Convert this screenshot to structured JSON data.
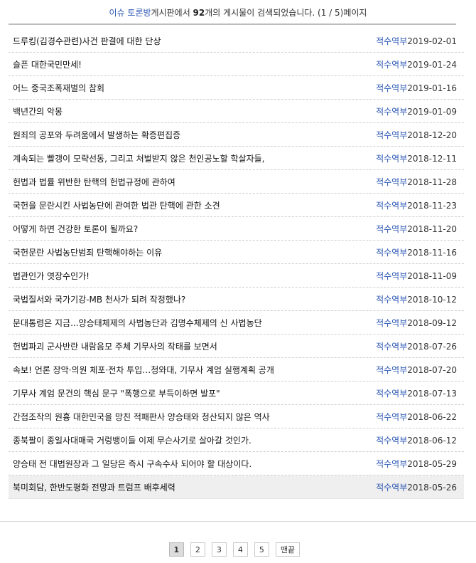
{
  "summary": {
    "board_name": "이슈 토론방",
    "text_after_board": "게시판에서 ",
    "count": "92",
    "text_after_count": "개의 게시물이 검색되었습니다. (1 / 5)페이지"
  },
  "posts": [
    {
      "title": "드루킹(김경수관련)사건 판결에 대한 단상",
      "author": "적수역부",
      "date": "2019-02-01"
    },
    {
      "title": "슬픈 대한국민만세!",
      "author": "적수역부",
      "date": "2019-01-24"
    },
    {
      "title": "어느 중국조폭재벌의 참회",
      "author": "적수역부",
      "date": "2019-01-16"
    },
    {
      "title": "백년간의 악몽",
      "author": "적수역부",
      "date": "2019-01-09"
    },
    {
      "title": "원죄의 공포와 두려움에서 발생하는 확증편집증",
      "author": "적수역부",
      "date": "2018-12-20"
    },
    {
      "title": "계속되는 빨갱이 모략선동, 그리고 처벌받지 않은 천인공노할 학살자들,",
      "author": "적수역부",
      "date": "2018-12-11"
    },
    {
      "title": "헌법과 법률 위반한 탄핵의 헌법규정에 관하여",
      "author": "적수역부",
      "date": "2018-11-28"
    },
    {
      "title": "국헌을 문란시킨 사법농단에 관여한 법관 탄핵에 관한 소견",
      "author": "적수역부",
      "date": "2018-11-23"
    },
    {
      "title": "어떻게 하면 건강한 토론이 될까요?",
      "author": "적수역부",
      "date": "2018-11-20"
    },
    {
      "title": "국헌문란 사법농단범죄 탄핵해야하는 이유",
      "author": "적수역부",
      "date": "2018-11-16"
    },
    {
      "title": "법관인가 엿장수인가!",
      "author": "적수역부",
      "date": "2018-11-09"
    },
    {
      "title": "국법질서와 국가기강-MB 천사가 되려 작정했나?",
      "author": "적수역부",
      "date": "2018-10-12"
    },
    {
      "title": "문대통령은 지금...양승태체제의 사법농단과 김명수체제의 신 사법농단",
      "author": "적수역부",
      "date": "2018-09-12"
    },
    {
      "title": "헌법파괴 군사반란 내람음모 주체 기무사의 작태를 보면서",
      "author": "적수역부",
      "date": "2018-07-26"
    },
    {
      "title": "속보! 언론 장악·의원 체포·전차 투입…청와대, 기무사 계엄 실행계획 공개",
      "author": "적수역부",
      "date": "2018-07-20"
    },
    {
      "title": "기무사 계엄 문건의 핵심 문구 \"폭행으로 부득이하면 발포\"",
      "author": "적수역부",
      "date": "2018-07-13"
    },
    {
      "title": "간첩조작의 원흉 대한민국을 망친 적패판사 양승태와 청산되지 않은 역사",
      "author": "적수역부",
      "date": "2018-06-22"
    },
    {
      "title": "종북팔이 종일사대매국 거렁뱅이들 이제 무슨사기로 살아갈 것인가.",
      "author": "적수역부",
      "date": "2018-06-12"
    },
    {
      "title": "양승태 전 대법원장과 그 일당은 즉시 구속수사 되어야 할 대상이다.",
      "author": "적수역부",
      "date": "2018-05-29"
    },
    {
      "title": "북미회담, 한반도평화 전망과 트럼프 배후세력",
      "author": "적수역부",
      "date": "2018-05-26"
    }
  ],
  "pagination": {
    "pages": [
      "1",
      "2",
      "3",
      "4",
      "5"
    ],
    "current": "1",
    "last_label": "맨끝"
  }
}
